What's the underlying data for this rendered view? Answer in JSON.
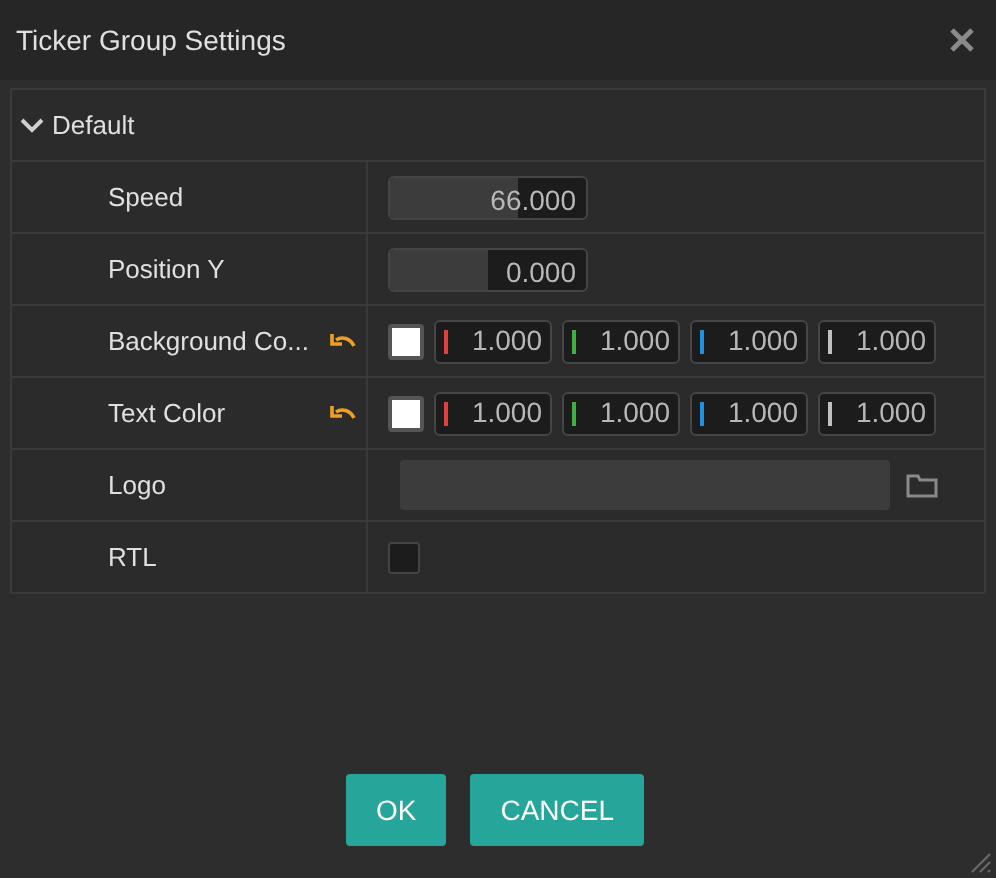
{
  "window": {
    "title": "Ticker Group Settings"
  },
  "section": {
    "title": "Default",
    "expanded": true
  },
  "properties": [
    {
      "label": "Speed",
      "kind": "slider",
      "modified": false,
      "value": "66.000",
      "level": 0.65
    },
    {
      "label": "Position Y",
      "kind": "slider",
      "modified": false,
      "value": "0.000",
      "level": 0.5
    },
    {
      "label": "Background Co...",
      "kind": "color",
      "modified": true,
      "color": "#ffffff",
      "channels": [
        {
          "value": "1.000",
          "color": "#e04040"
        },
        {
          "value": "1.000",
          "color": "#40b040"
        },
        {
          "value": "1.000",
          "color": "#2090e0"
        },
        {
          "value": "1.000",
          "color": "#c0c0c0"
        }
      ]
    },
    {
      "label": "Text Color",
      "kind": "color",
      "modified": true,
      "color": "#ffffff",
      "channels": [
        {
          "value": "1.000",
          "color": "#e04040"
        },
        {
          "value": "1.000",
          "color": "#40b040"
        },
        {
          "value": "1.000",
          "color": "#2090e0"
        },
        {
          "value": "1.000",
          "color": "#c0c0c0"
        }
      ]
    },
    {
      "label": "Logo",
      "kind": "file",
      "modified": false
    },
    {
      "label": "RTL",
      "kind": "checkbox",
      "modified": false,
      "checked": false
    }
  ],
  "buttons": [
    "OK",
    "CANCEL"
  ]
}
